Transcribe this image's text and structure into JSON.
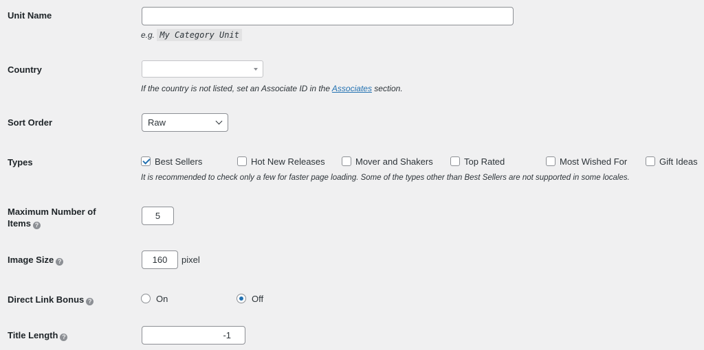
{
  "unit_name": {
    "label": "Unit Name",
    "value": "",
    "example_prefix": "e.g.",
    "example_code": "My Category Unit"
  },
  "country": {
    "label": "Country",
    "selected": "",
    "desc_before": "If the country is not listed, set an Associate ID in the",
    "desc_link": "Associates",
    "desc_after": "section."
  },
  "sort_order": {
    "label": "Sort Order",
    "selected": "Raw"
  },
  "types": {
    "label": "Types",
    "options": [
      {
        "label": "Best Sellers",
        "checked": true
      },
      {
        "label": "Hot New Releases",
        "checked": false
      },
      {
        "label": "Mover and Shakers",
        "checked": false
      },
      {
        "label": "Top Rated",
        "checked": false
      },
      {
        "label": "Most Wished For",
        "checked": false
      },
      {
        "label": "Gift Ideas",
        "checked": false
      }
    ],
    "desc": "It is recommended to check only a few for faster page loading. Some of the types other than Best Sellers are not supported in some locales."
  },
  "max_items": {
    "label_line1": "Maximum Number of",
    "label_line2": "Items",
    "value": "5"
  },
  "image_size": {
    "label": "Image Size",
    "value": "160",
    "unit": "pixel"
  },
  "direct_link_bonus": {
    "label": "Direct Link Bonus",
    "options": [
      {
        "label": "On",
        "checked": false
      },
      {
        "label": "Off",
        "checked": true
      }
    ]
  },
  "title_length": {
    "label": "Title Length",
    "value": "-1"
  },
  "help_icon_glyph": "?",
  "colors": {
    "background": "#f0f0f1",
    "accent": "#2271b1",
    "border": "#8c8f94"
  }
}
